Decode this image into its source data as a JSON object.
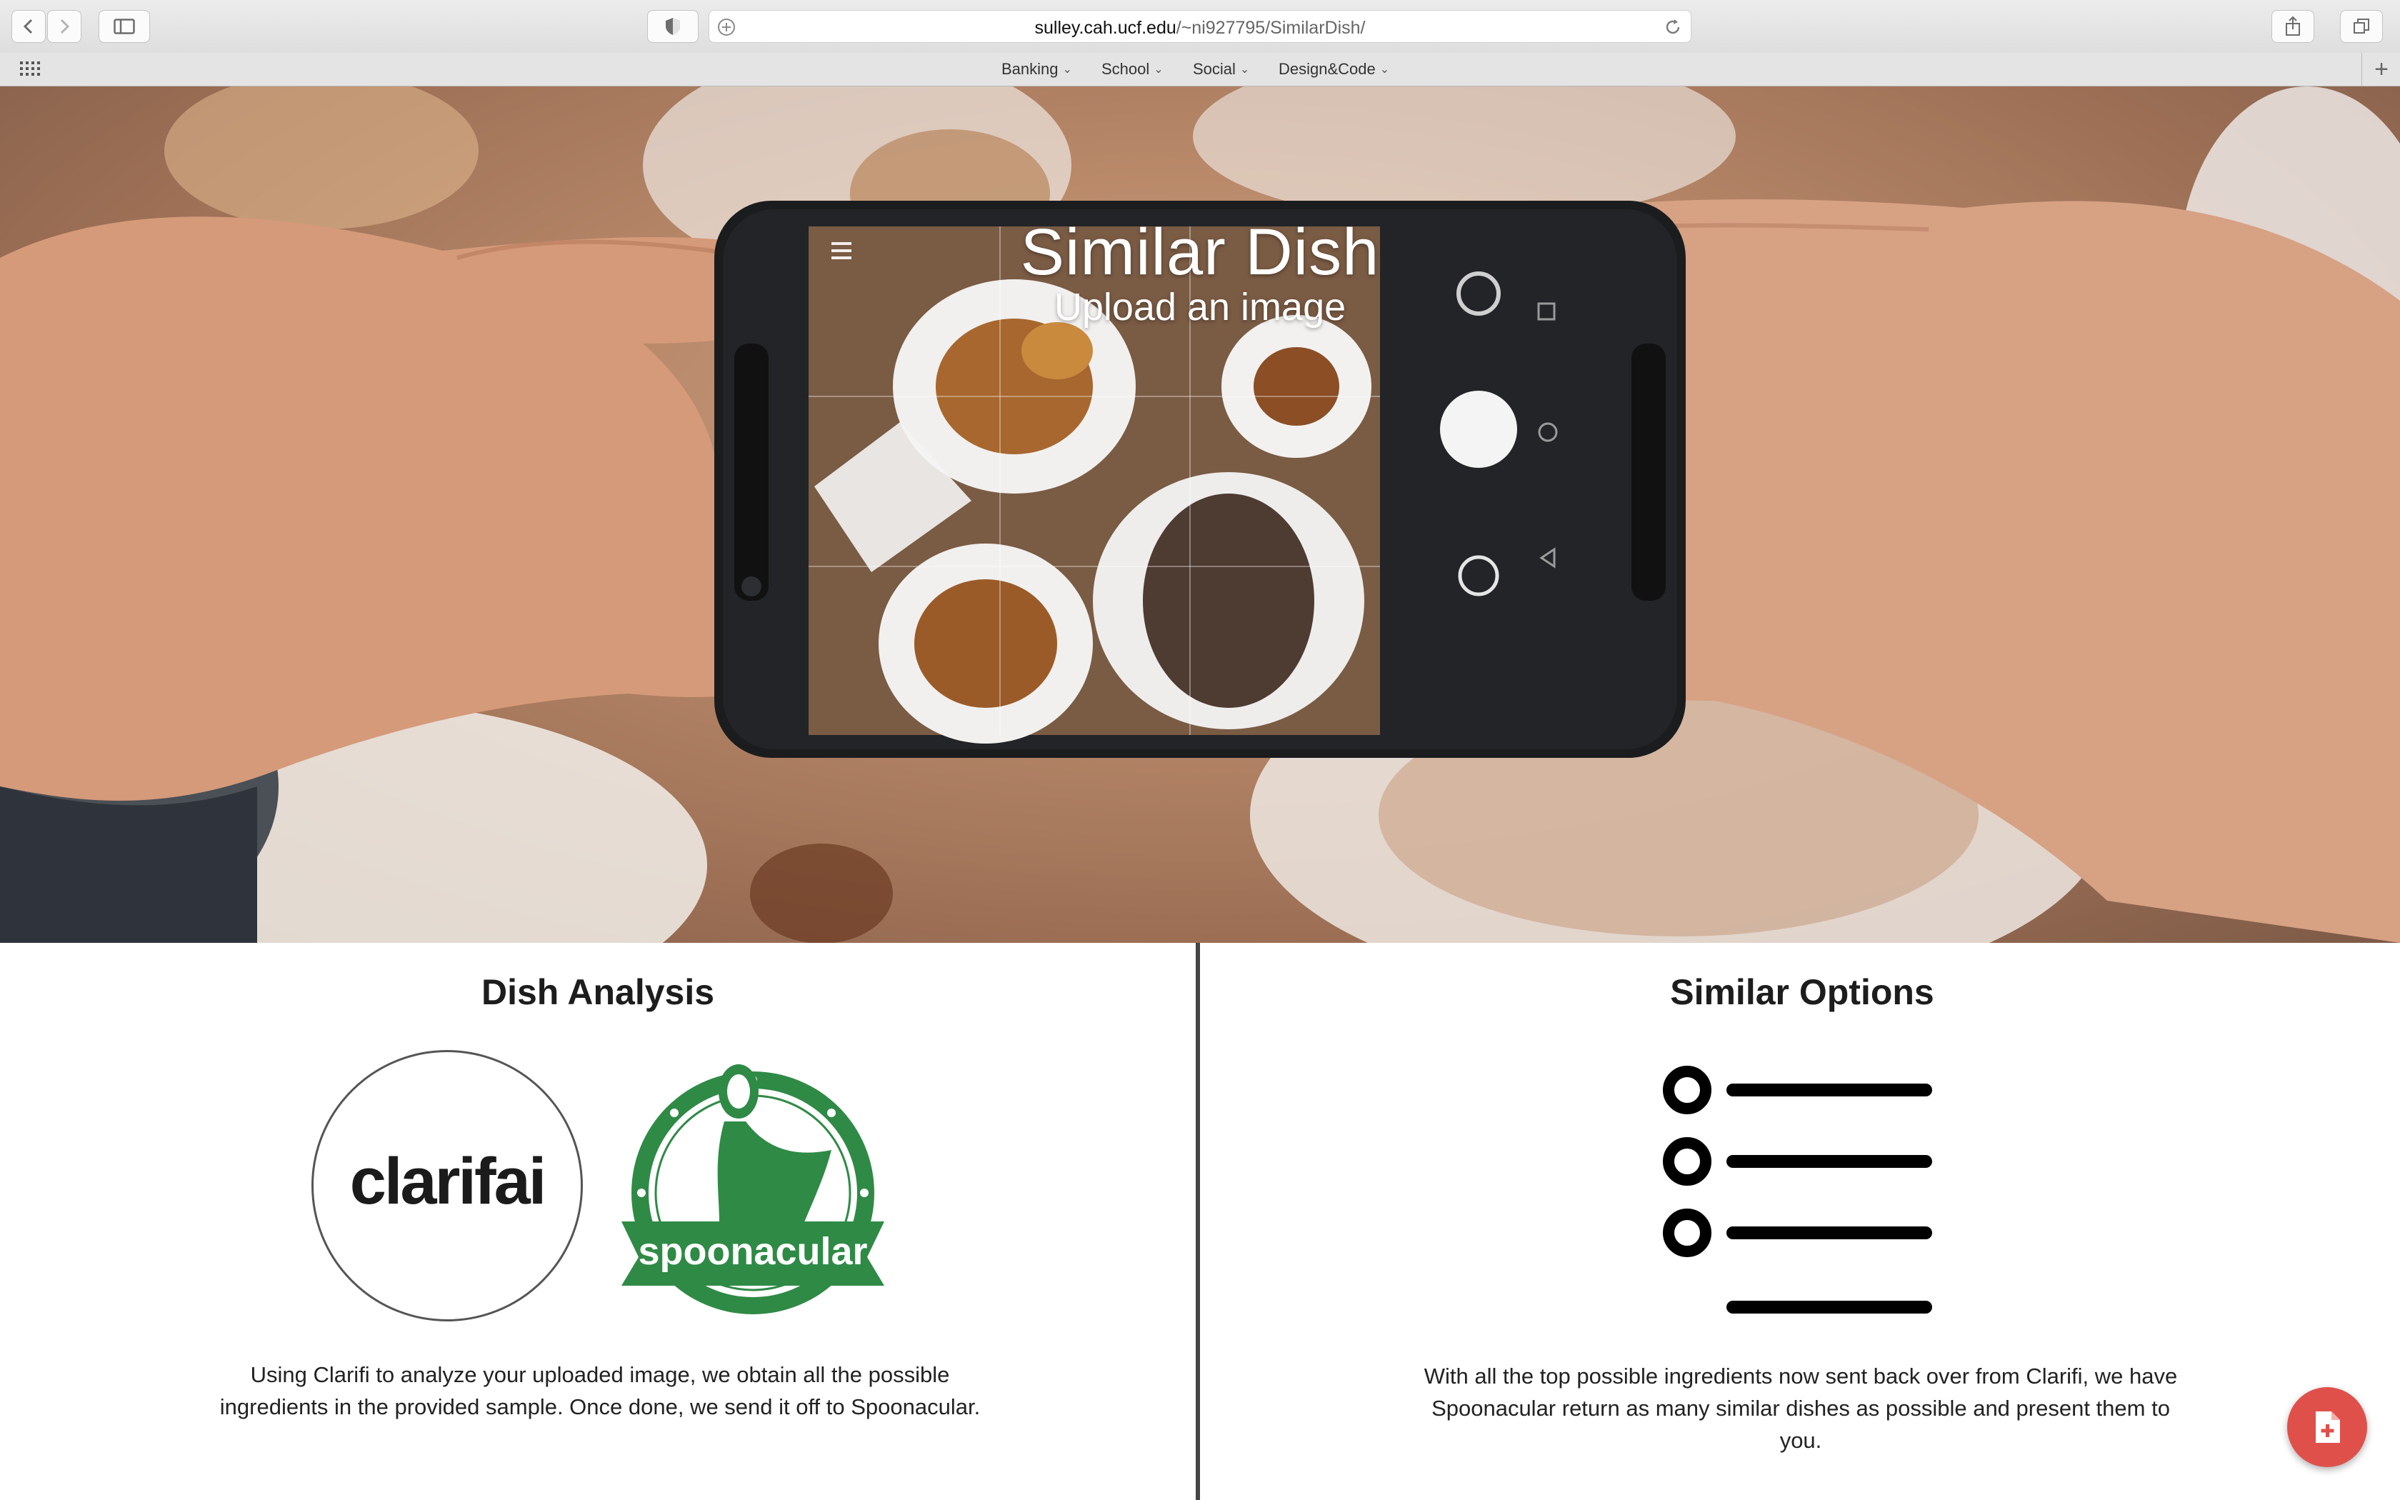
{
  "browser": {
    "url_host": "sulley.cah.ucf.edu",
    "url_path": "/~ni927795/SimilarDish/",
    "bookmarks": [
      "Banking",
      "School",
      "Social",
      "Design&Code"
    ]
  },
  "hero": {
    "title": "Similar Dish",
    "subtitle": "Upload an image"
  },
  "dish_analysis": {
    "heading": "Dish Analysis",
    "logo_clarifai": "clarifai",
    "logo_spoonacular": "spoonacular",
    "description": "Using Clarifi to analyze your uploaded image, we obtain all the possible ingredients in the provided sample. Once done, we send it off to Spoonacular."
  },
  "similar_options": {
    "heading": "Similar Options",
    "icon": "list-icon",
    "description": "With all the top possible ingredients now sent back over from Clarifi, we have Spoonacular return as many similar dishes as possible and present them to you."
  },
  "fab": {
    "icon": "add-file-icon",
    "color": "#e0504b"
  }
}
